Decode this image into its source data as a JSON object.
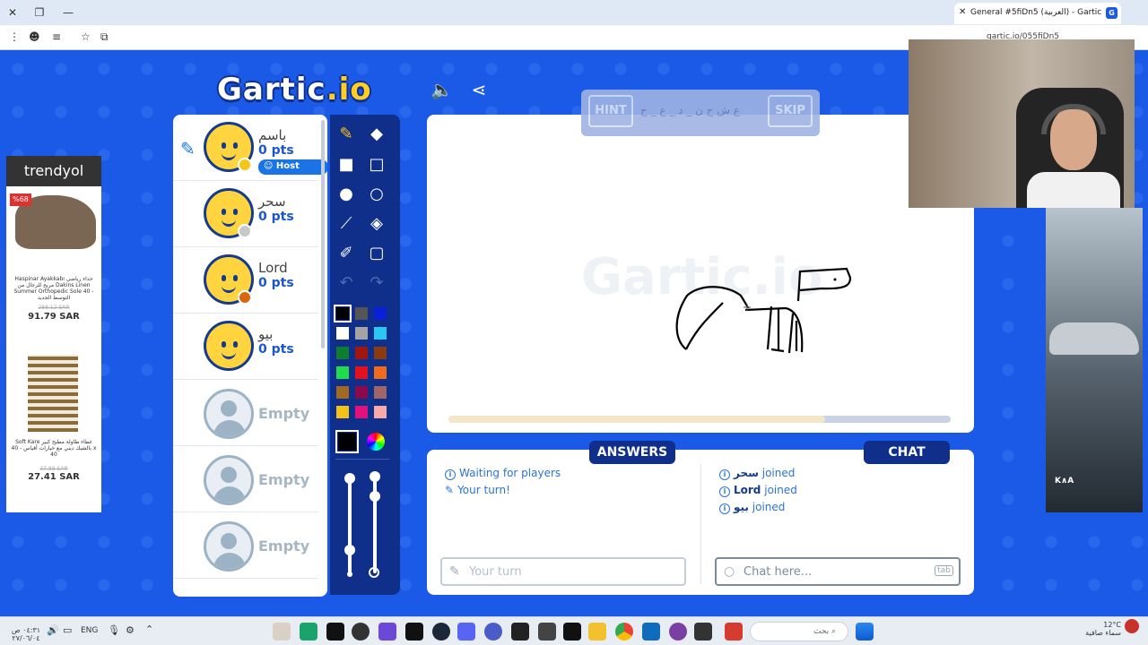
{
  "browser": {
    "tab_title": "General #5fiDn5 (العربية) - Gartic",
    "tab_favicon": "G",
    "url": "gartic.io/055fiDn5",
    "new_tab_label": "+"
  },
  "logo": {
    "main": "Gartic",
    "suffix": ".io"
  },
  "players": [
    {
      "name": "باسم",
      "points": "0 pts",
      "badge": "Host",
      "status_color": "#f5c518"
    },
    {
      "name": "سحر",
      "points": "0 pts",
      "status_color": "#c8c8c8"
    },
    {
      "name": "Lord",
      "points": "0 pts",
      "status_color": "#d9650c"
    },
    {
      "name": "بيو",
      "points": "0 pts"
    }
  ],
  "empty_slots": [
    "Empty",
    "Empty",
    "Empty"
  ],
  "tools": {
    "palette": [
      "#000000",
      "#555555",
      "#0a1fd9",
      "#ffffff",
      "#a4a4a4",
      "#2ac7f2",
      "#0d7d2e",
      "#a3160f",
      "#8c3b11",
      "#1edc4c",
      "#e3101d",
      "#f26a1b",
      "#a06a22",
      "#8c0a4a",
      "#a06666",
      "#f0c21a",
      "#e2127a",
      "#f7aaa9"
    ],
    "selected_color": "#000000"
  },
  "word_bar": {
    "hint_label": "HINT",
    "skip_label": "SKIP",
    "letters": "ع ش ح ن _ د _ ع _ ح"
  },
  "canvas": {
    "watermark": "Gartic.io",
    "timer_progress": 0.75
  },
  "answers": {
    "tab_label": "ANSWERS",
    "messages": [
      "Waiting for players",
      "Your turn!"
    ],
    "input_placeholder": "Your turn"
  },
  "chat": {
    "tab_label": "CHAT",
    "messages": [
      {
        "user": "سحر",
        "text": "joined"
      },
      {
        "user": "Lord",
        "text": "joined"
      },
      {
        "user": "بيو",
        "text": "joined"
      }
    ],
    "input_placeholder": "Chat here...",
    "tab_key": "tab"
  },
  "ad_left": {
    "brand": "trendyol",
    "discount": "%68",
    "product1": "Haspinar Ayakkabı حذاء رياضي مريح للرجال من Dakins Linen Summer Orthopedic Sole 40 - التوسط الجديد",
    "old_price1": "288.12 SAR",
    "price1": "91.79 SAR",
    "product2": "Soft Kare غطاء طاولة مطبخ كبير بالشبك ديني مع خيارات أقياس - 40 x 40",
    "old_price2": "37.88 SAR",
    "price2": "27.41 SAR"
  },
  "taskbar": {
    "search_text": "بحث",
    "language": "ENG",
    "time": "٠٤:٣١ ص",
    "date": "٢٧/٠٦/٠٤",
    "weather_temp": "12°C",
    "weather_text": "سماء صافية"
  }
}
